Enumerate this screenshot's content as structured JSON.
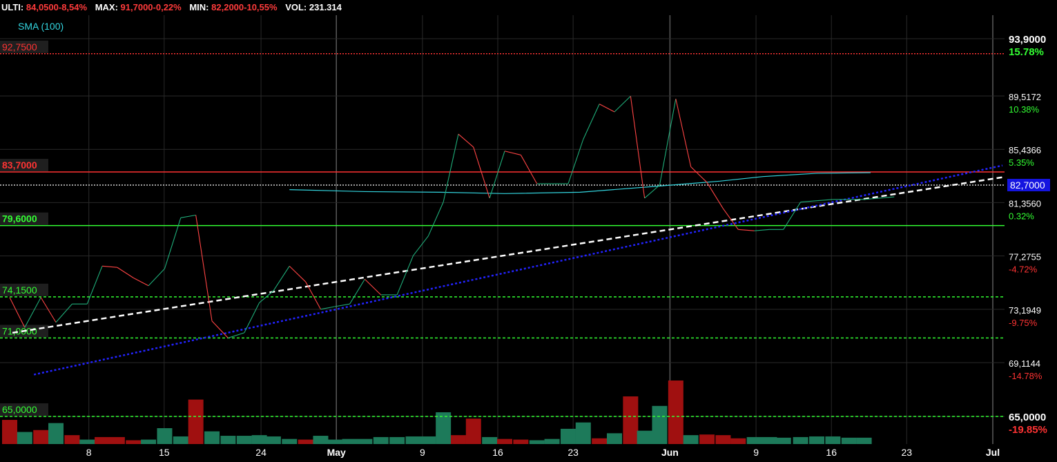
{
  "header": {
    "ulti_label": "ULTI:",
    "ulti_value": "84,0500-8,54%",
    "max_label": "MAX:",
    "max_value": "91,7000-0,22%",
    "min_label": "MIN:",
    "min_value": "82,2000-10,55%",
    "vol_label": "VOL:",
    "vol_value": "231.314"
  },
  "colors": {
    "up_line": "#1fae7a",
    "down_line": "#ff4444",
    "sma": "#33d6e0",
    "resistance": "#ff3333",
    "support": "#33ff33",
    "current": "#ffffff",
    "trend_blue": "#2323ff",
    "vol_up": "#1d7a5a",
    "vol_down": "#a01010",
    "pct_pos": "#33ff33",
    "pct_neg": "#ff3333"
  },
  "chart_data": {
    "type": "line",
    "legend": "SMA (100)",
    "x_ticks": [
      {
        "label": "8",
        "day": 8,
        "major": false
      },
      {
        "label": "15",
        "day": 15,
        "major": false
      },
      {
        "label": "24",
        "day": 24,
        "major": false
      },
      {
        "label": "May",
        "day": 31,
        "major": true
      },
      {
        "label": "9",
        "day": 39,
        "major": false
      },
      {
        "label": "16",
        "day": 46,
        "major": false
      },
      {
        "label": "23",
        "day": 53,
        "major": false
      },
      {
        "label": "Jun",
        "day": 62,
        "major": true
      },
      {
        "label": "9",
        "day": 70,
        "major": false
      },
      {
        "label": "16",
        "day": 77,
        "major": false
      },
      {
        "label": "23",
        "day": 84,
        "major": false
      },
      {
        "label": "Jul",
        "day": 92,
        "major": true
      }
    ],
    "x_range": [
      0,
      92
    ],
    "y_range": [
      65.0,
      93.9
    ],
    "y_ticks": [
      {
        "value": 93.9,
        "label": "93,9000",
        "pct": "15.78%"
      },
      {
        "value": 89.5172,
        "label": "89,5172",
        "pct": "10.38%"
      },
      {
        "value": 85.4366,
        "label": "85,4366",
        "pct": "5.35%"
      },
      {
        "value": 81.356,
        "label": "81,3560",
        "pct": "0.32%"
      },
      {
        "value": 77.2755,
        "label": "77,2755",
        "pct": "-4.72%"
      },
      {
        "value": 73.1949,
        "label": "73,1949",
        "pct": "-9.75%"
      },
      {
        "value": 69.1144,
        "label": "69,1144",
        "pct": "-14.78%"
      },
      {
        "value": 65.0,
        "label": "65,0000",
        "pct": "-19.85%"
      }
    ],
    "price": {
      "x": [
        0,
        1.4,
        2.9,
        4.3,
        5.8,
        7.2,
        8.6,
        10,
        11.5,
        12.9,
        14.4,
        15.9,
        17.3,
        18.8,
        20.3,
        21.8,
        23.2,
        24.5,
        26,
        27.5,
        28.9,
        30.2,
        31.6,
        33,
        34.5,
        36,
        37.5,
        38.9,
        40.3,
        41.7,
        43.1,
        44.6,
        46,
        47.5,
        49,
        50.4,
        51.9,
        53.3,
        54.8,
        56.2,
        57.7,
        59,
        60.4,
        61.9,
        63.3,
        64.8,
        66.3,
        67.7,
        69.2,
        70.6,
        71.9,
        73.5,
        75,
        76.5,
        78,
        79.4,
        80.8,
        82.2
      ],
      "y": [
        74.1,
        71.8,
        74.1,
        72.2,
        73.6,
        73.6,
        76.5,
        76.4,
        75.6,
        75.0,
        76.3,
        80.2,
        80.4,
        72.3,
        71.0,
        71.4,
        73.7,
        74.6,
        76.5,
        75.3,
        73.2,
        73.4,
        73.6,
        75.5,
        74.3,
        74.3,
        77.3,
        78.8,
        81.4,
        86.6,
        85.6,
        81.7,
        85.3,
        85.0,
        82.8,
        82.8,
        82.8,
        86.2,
        88.9,
        88.3,
        89.5,
        81.7,
        82.7,
        89.3,
        84.1,
        82.9,
        80.9,
        79.3,
        79.2,
        79.3,
        79.3,
        81.4,
        81.5,
        81.6,
        81.6,
        81.6,
        81.7,
        81.8
      ]
    },
    "sma": {
      "x": [
        26,
        33,
        40,
        46,
        53,
        60,
        66,
        70,
        75,
        80
      ],
      "y": [
        82.35,
        82.2,
        82.15,
        82.05,
        82.15,
        82.6,
        83.0,
        83.35,
        83.6,
        83.65
      ]
    },
    "levels": [
      {
        "value": 92.75,
        "label": "92,7500",
        "kind": "resistance",
        "style": "dotted"
      },
      {
        "value": 83.7,
        "label": "83,7000",
        "kind": "resistance",
        "style": "solid"
      },
      {
        "value": 79.6,
        "label": "79,6000",
        "kind": "support",
        "style": "solid"
      },
      {
        "value": 74.15,
        "label": "74,1500",
        "kind": "support",
        "style": "dashed"
      },
      {
        "value": 71.0,
        "label": "71,0000",
        "kind": "support",
        "style": "dashed"
      },
      {
        "value": 65.0,
        "label": "65,0000",
        "kind": "support",
        "style": "dashed"
      }
    ],
    "current": {
      "value": 82.7,
      "label": "82,7000"
    },
    "trend_white": {
      "x": [
        0,
        92
      ],
      "y": [
        71.4,
        83.3
      ]
    },
    "trend_blue": {
      "x": [
        2,
        92
      ],
      "y": [
        68.2,
        84.2
      ]
    },
    "volume": {
      "max": 100,
      "x": [
        0,
        1.4,
        2.9,
        4.3,
        5.8,
        7.2,
        8.6,
        10,
        11.5,
        12.9,
        14.4,
        15.9,
        17.3,
        18.8,
        20.3,
        21.8,
        23.2,
        24.5,
        26,
        27.5,
        28.9,
        30.2,
        31.6,
        33,
        34.5,
        36,
        37.5,
        38.9,
        40.3,
        41.7,
        43.1,
        44.6,
        46,
        47.5,
        49,
        50.4,
        51.9,
        53.3,
        54.8,
        56.2,
        57.7,
        59,
        60.4,
        61.9,
        63.3,
        64.8,
        66.3,
        67.7,
        69.2,
        70.6,
        71.9,
        73.5,
        75,
        76.5,
        78,
        79.4
      ],
      "values": [
        38,
        19,
        22,
        33,
        14,
        7,
        11,
        11,
        6,
        7,
        25,
        12,
        70,
        20,
        13,
        13,
        14,
        12,
        8,
        7,
        13,
        7,
        8,
        8,
        11,
        11,
        12,
        12,
        50,
        14,
        40,
        11,
        8,
        7,
        6,
        8,
        24,
        34,
        9,
        17,
        75,
        21,
        60,
        100,
        14,
        15,
        14,
        9,
        11,
        11,
        10,
        11,
        12,
        12,
        10,
        10
      ],
      "direction": [
        "d",
        "u",
        "d",
        "u",
        "d",
        "u",
        "d",
        "d",
        "d",
        "u",
        "u",
        "u",
        "d",
        "u",
        "u",
        "u",
        "u",
        "u",
        "u",
        "d",
        "u",
        "u",
        "u",
        "u",
        "u",
        "u",
        "u",
        "u",
        "u",
        "d",
        "d",
        "u",
        "d",
        "d",
        "u",
        "u",
        "u",
        "u",
        "d",
        "u",
        "d",
        "u",
        "u",
        "d",
        "u",
        "d",
        "d",
        "d",
        "u",
        "u",
        "u",
        "u",
        "u",
        "u",
        "u",
        "u"
      ]
    }
  }
}
